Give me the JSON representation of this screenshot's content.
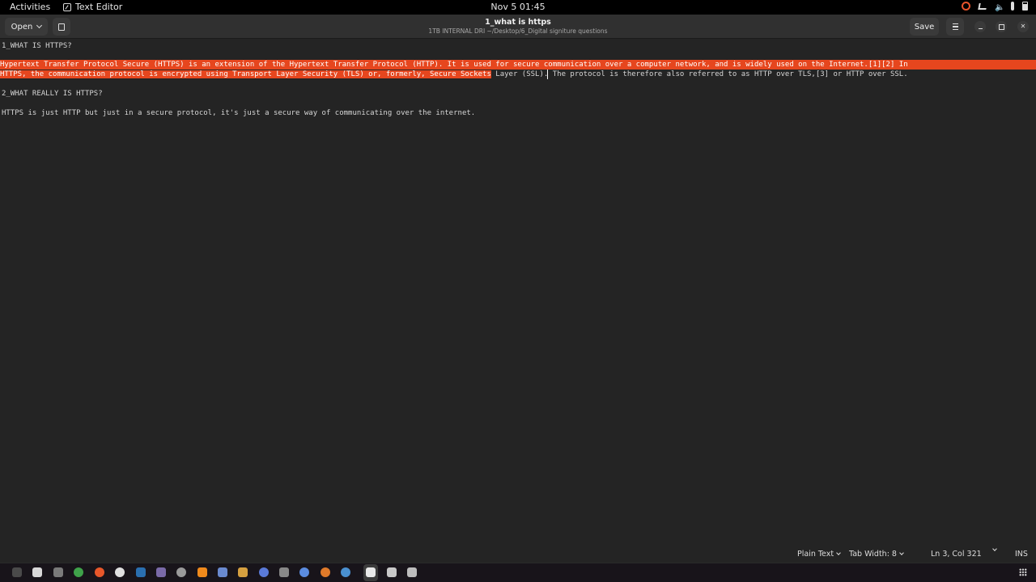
{
  "topbar": {
    "activities": "Activities",
    "app_name": "Text Editor",
    "datetime": "Nov 5  01:45",
    "tray_icons": [
      "ubuntu-icon",
      "network-icon",
      "volume-icon",
      "microphone-icon",
      "battery-icon"
    ]
  },
  "header": {
    "open_label": "Open",
    "title": "1_what is https",
    "path": "1TB INTERNAL DRI ~/Desktop/6_Digital signiture questions",
    "save_label": "Save"
  },
  "editor": {
    "lines": [
      "1_WHAT IS HTTPS?",
      "",
      "Hypertext Transfer Protocol Secure (HTTPS) is an extension of the Hypertext Transfer Protocol (HTTP). It is used for secure communication over a computer network, and is widely used on the Internet.[1][2] In",
      "HTTPS, the communication protocol is encrypted using Transport Layer Security (TLS) or, formerly, Secure Sockets",
      " Layer (SSL). The protocol is therefore also referred to as HTTP over TLS,[3] or HTTP over SSL.",
      "",
      "2_WHAT REALLY IS HTTPS?",
      "",
      "HTTPS is just HTTP but just in a secure protocol, it's just a secure way of communicating over the internet."
    ],
    "selection_color": "#e6461e"
  },
  "status": {
    "language": "Plain Text",
    "tab_width": "Tab Width: 8",
    "position": "Ln 3, Col 321",
    "mode": "INS"
  },
  "dock": {
    "apps": [
      {
        "name": "terminal-icon",
        "color": "#4a4a4a"
      },
      {
        "name": "notes-icon",
        "color": "#d8d8d8"
      },
      {
        "name": "files-icon",
        "color": "#7a7a7a"
      },
      {
        "name": "chrome-icon",
        "color": "#3fa24a"
      },
      {
        "name": "firefox-icon",
        "color": "#e8572a"
      },
      {
        "name": "github-icon",
        "color": "#e0e0e0"
      },
      {
        "name": "steam-icon",
        "color": "#2a6fb0"
      },
      {
        "name": "app-icon",
        "color": "#7a6aa8"
      },
      {
        "name": "compass-icon",
        "color": "#9a9a9a"
      },
      {
        "name": "vlc-icon",
        "color": "#f08a1c"
      },
      {
        "name": "vscode-icon",
        "color": "#6a8ad0"
      },
      {
        "name": "paint-icon",
        "color": "#d6a040"
      },
      {
        "name": "clock-icon",
        "color": "#5a7ad8"
      },
      {
        "name": "keyboard-icon",
        "color": "#888888"
      },
      {
        "name": "chat-icon",
        "color": "#5b8ce0"
      },
      {
        "name": "blender-icon",
        "color": "#e07a2a"
      },
      {
        "name": "globe-icon",
        "color": "#4a90d0"
      },
      {
        "name": "text-editor-icon",
        "color": "#e8e8e8"
      },
      {
        "name": "document-icon",
        "color": "#c8c8c8"
      },
      {
        "name": "trash-icon",
        "color": "#bdbdbd"
      }
    ]
  }
}
